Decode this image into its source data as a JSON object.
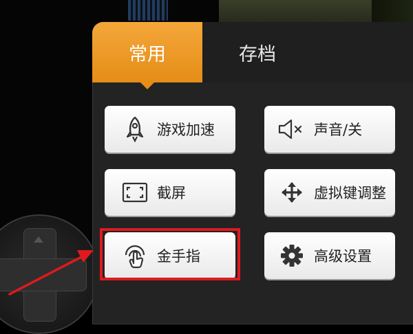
{
  "tabs": [
    {
      "label": "常用",
      "active": true
    },
    {
      "label": "存档",
      "active": false
    }
  ],
  "buttons": {
    "speed": {
      "label": "游戏加速",
      "icon": "rocket-icon"
    },
    "sound": {
      "label": "声音/关",
      "icon": "speaker-muted-icon"
    },
    "screenshot": {
      "label": "截屏",
      "icon": "screenshot-frame-icon"
    },
    "virtual_keys": {
      "label": "虚拟键调整",
      "icon": "move-arrows-icon"
    },
    "cheats": {
      "label": "金手指",
      "icon": "finger-touch-icon"
    },
    "advanced": {
      "label": "高级设置",
      "icon": "gear-icon"
    }
  },
  "colors": {
    "active_tab": "#f0a030",
    "panel": "#232323",
    "highlight": "#e0191f"
  }
}
